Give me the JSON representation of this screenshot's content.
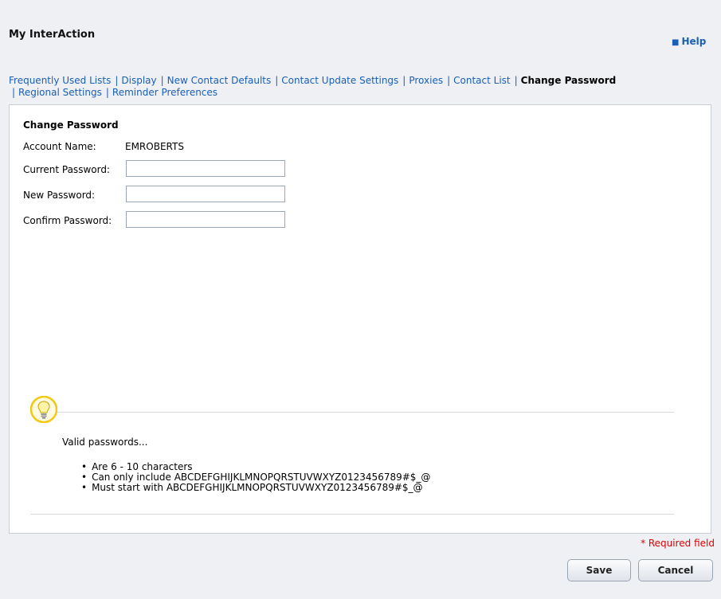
{
  "header": {
    "title": "My InterAction",
    "help_label": "Help"
  },
  "tabs": [
    {
      "label": "Frequently Used Lists"
    },
    {
      "label": "Display"
    },
    {
      "label": "New Contact Defaults"
    },
    {
      "label": "Contact Update Settings"
    },
    {
      "label": "Proxies"
    },
    {
      "label": "Contact List"
    },
    {
      "label": "Change Password",
      "active": true
    },
    {
      "label": "Regional Settings"
    },
    {
      "label": "Reminder Preferences"
    }
  ],
  "form": {
    "section_title": "Change Password",
    "account_name_label": "Account Name:",
    "account_name_value": "EMROBERTS",
    "current_password_label": "Current Password:",
    "current_password_value": "",
    "new_password_label": "New Password:",
    "new_password_value": "",
    "confirm_password_label": "Confirm Password:",
    "confirm_password_value": ""
  },
  "hint": {
    "icon": "lightbulb-icon",
    "intro": "Valid passwords...",
    "rules": [
      "Are 6 - 10 characters",
      "Can only include ABCDEFGHIJKLMNOPQRSTUVWXYZ0123456789#$_@",
      "Must start with ABCDEFGHIJKLMNOPQRSTUVWXYZ0123456789#$_@"
    ]
  },
  "footer": {
    "required_note": "* Required field",
    "save_label": "Save",
    "cancel_label": "Cancel"
  },
  "colors": {
    "link": "#1a5fb4",
    "required": "#e00000",
    "background": "#eef0f4",
    "bulb": "#f3c817"
  }
}
